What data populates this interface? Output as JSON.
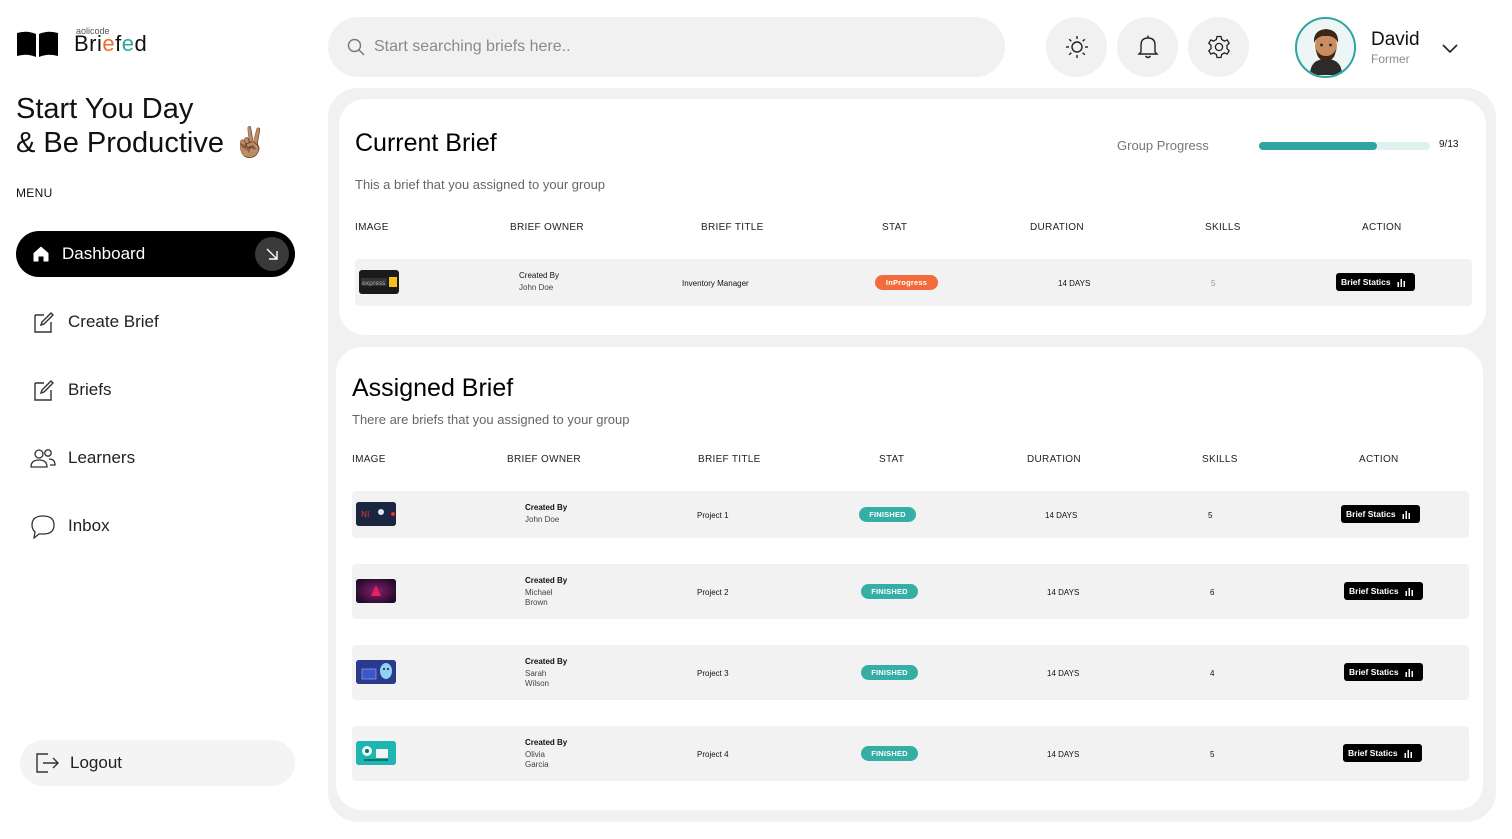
{
  "app": {
    "logo_small": "aolicode",
    "logo_parts": [
      "Bri",
      "e",
      "f",
      "e",
      "d"
    ],
    "greeting_line1": "Start You Day",
    "greeting_line2": "& Be Productive ✌🏽"
  },
  "sidebar": {
    "menu_label": "MENU",
    "items": [
      {
        "label": "Dashboard",
        "icon": "home-icon",
        "active": true
      },
      {
        "label": "Create Brief",
        "icon": "edit-icon"
      },
      {
        "label": "Briefs",
        "icon": "edit-icon"
      },
      {
        "label": "Learners",
        "icon": "users-icon"
      },
      {
        "label": "Inbox",
        "icon": "chat-icon"
      }
    ],
    "logout_label": "Logout"
  },
  "topbar": {
    "search_placeholder": "Start searching briefs here..",
    "icons": [
      "sun-icon",
      "bell-icon",
      "gear-icon"
    ],
    "user_name": "David",
    "user_role": "Former"
  },
  "current": {
    "title": "Current Brief",
    "subtitle": "This a brief that you assigned to your group",
    "progress_label": "Group Progress",
    "progress_done": 9,
    "progress_total": 13,
    "progress_text": "9/13",
    "headers": [
      "IMAGE",
      "BRIEF OWNER",
      "BRIEF TITLE",
      "STAT",
      "DURATION",
      "SKILLS",
      "ACTION"
    ],
    "row": {
      "owner_label": "Created By",
      "owner_name": "John Doe",
      "title": "Inventory Manager",
      "status": "InProgress",
      "duration": "14 DAYS",
      "skills": "5",
      "action": "Brief Statics"
    }
  },
  "assigned": {
    "title": "Assigned Brief",
    "subtitle": "There are briefs that you assigned to your group",
    "headers": [
      "IMAGE",
      "BRIEF OWNER",
      "BRIEF TITLE",
      "STAT",
      "DURATION",
      "SKILLS",
      "ACTION"
    ],
    "rows": [
      {
        "owner_label": "Created By",
        "owner_name": "John Doe",
        "title": "Project 1",
        "status": "FINISHED",
        "duration": "14 DAYS",
        "skills": "5",
        "action": "Brief Statics"
      },
      {
        "owner_label": "Created By",
        "owner_name": "Michael Brown",
        "title": "Project 2",
        "status": "FINISHED",
        "duration": "14 DAYS",
        "skills": "6",
        "action": "Brief Statics"
      },
      {
        "owner_label": "Created By",
        "owner_name": "Sarah Wilson",
        "title": "Project 3",
        "status": "FINISHED",
        "duration": "14 DAYS",
        "skills": "4",
        "action": "Brief Statics"
      },
      {
        "owner_label": "Created By",
        "owner_name": "Olivia Garcia",
        "title": "Project 4",
        "status": "FINISHED",
        "duration": "14 DAYS",
        "skills": "5",
        "action": "Brief Statics"
      }
    ]
  },
  "colors": {
    "accent": "#2fa4a0",
    "orange": "#f26b3a",
    "dark": "#000000"
  }
}
